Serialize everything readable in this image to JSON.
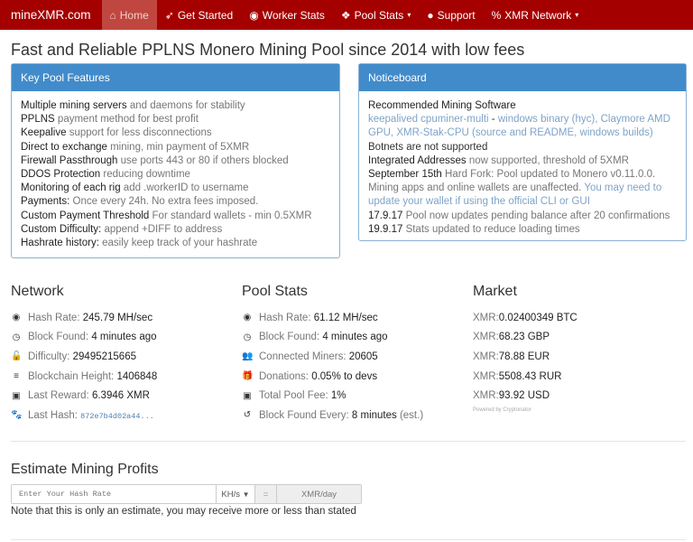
{
  "nav": {
    "brand": "mineXMR.com",
    "items": [
      {
        "label": "Home",
        "icon": "home-icon"
      },
      {
        "label": "Get Started",
        "icon": "rocket-icon"
      },
      {
        "label": "Worker Stats",
        "icon": "dashboard-icon"
      },
      {
        "label": "Pool Stats",
        "icon": "cubes-icon",
        "caret": "▾"
      },
      {
        "label": "Support",
        "icon": "comments-icon"
      },
      {
        "label": "XMR Network",
        "icon": "link-icon",
        "caret": "▾"
      }
    ]
  },
  "title": "Fast and Reliable PPLNS Monero Mining Pool since 2014 with low fees",
  "features": {
    "title": "Key Pool Features",
    "items": [
      [
        "Multiple mining servers",
        "and daemons for stability"
      ],
      [
        "PPLNS",
        "payment method for best profit"
      ],
      [
        "Keepalive",
        "support for less disconnections"
      ],
      [
        "Direct to exchange",
        "mining, min payment of 5XMR"
      ],
      [
        "Firewall Passthrough",
        "use ports 443 or 80 if others blocked"
      ],
      [
        "DDOS Protection",
        "reducing downtime"
      ],
      [
        "Monitoring of each rig",
        "add .workerID to username"
      ],
      [
        "Payments:",
        "Once every 24h. No extra fees imposed."
      ],
      [
        "Custom Payment Threshold",
        "For standard wallets - min 0.5XMR"
      ],
      [
        "Custom Difficulty:",
        "append +DIFF to address"
      ],
      [
        "Hashrate history:",
        "easily keep track of your hashrate"
      ]
    ]
  },
  "notice": {
    "title": "Noticeboard",
    "software_heading": "Recommended Mining Software",
    "link1": "keepalived cpuminer-multi",
    "sep1": " - ",
    "link2": "windows binary (hyc)",
    "sep2": ", ",
    "link3": "Claymore AMD GPU",
    "sep3": ", ",
    "link4": "XMR-Stak-CPU",
    "paren_open": " (",
    "link5": "source and README",
    "sep4": ", ",
    "link6": "windows builds",
    "paren_close": ")",
    "botnets": "Botnets are not supported",
    "ia_b": "Integrated Addresses",
    "ia_t": " now supported, threshold of 5XMR",
    "fork_b": "September 15th",
    "fork_t": " Hard Fork: Pool updated to Monero v0.11.0.0. Mining apps and online wallets are unaffected. ",
    "fork_l": "You may need to update your wallet if using the official CLI or GUI",
    "n1_b": "17.9.17",
    "n1_t": " Pool now updates pending balance after 20 confirmations",
    "n2_b": "19.9.17",
    "n2_t": " Stats updated to reduce loading times"
  },
  "network": {
    "title": "Network",
    "rows": [
      {
        "icon": "dashboard-icon",
        "glyph": "◉",
        "label": "Hash Rate: ",
        "value": "245.79 MH/sec"
      },
      {
        "icon": "clock-icon",
        "glyph": "◷",
        "label": "Block Found: ",
        "value": "4 minutes ago"
      },
      {
        "icon": "unlock-icon",
        "glyph": "🔓",
        "label": "Difficulty: ",
        "value": "29495215665"
      },
      {
        "icon": "bars-icon",
        "glyph": "≡",
        "label": "Blockchain Height: ",
        "value": "1406848"
      },
      {
        "icon": "money-icon",
        "glyph": "▣",
        "label": "Last Reward: ",
        "value": "6.3946 XMR"
      },
      {
        "icon": "paw-icon",
        "glyph": "🐾",
        "label": "Last Hash: ",
        "value": "872e7b4d02a44..."
      }
    ]
  },
  "pool": {
    "title": "Pool Stats",
    "rows": [
      {
        "icon": "dashboard-icon",
        "glyph": "◉",
        "label": "Hash Rate: ",
        "value": "61.12 MH/sec"
      },
      {
        "icon": "clock-icon",
        "glyph": "◷",
        "label": "Block Found: ",
        "value": "4 minutes ago"
      },
      {
        "icon": "users-icon",
        "glyph": "👥",
        "label": "Connected Miners: ",
        "value": "20605"
      },
      {
        "icon": "gift-icon",
        "glyph": "🎁",
        "label": "Donations: ",
        "value": "0.05% to devs"
      },
      {
        "icon": "money-icon",
        "glyph": "▣",
        "label": "Total Pool Fee: ",
        "value": "1%"
      },
      {
        "icon": "history-icon",
        "glyph": "↺",
        "label": "Block Found Every: ",
        "value": "8 minutes",
        "extra": " (est.)"
      }
    ]
  },
  "market": {
    "title": "Market",
    "rows": [
      {
        "label": "XMR: ",
        "value": "0.02400349 BTC"
      },
      {
        "label": "XMR: ",
        "value": "68.23 GBP"
      },
      {
        "label": "XMR: ",
        "value": "78.88 EUR"
      },
      {
        "label": "XMR: ",
        "value": "5508.43 RUR"
      },
      {
        "label": "XMR: ",
        "value": "93.92 USD"
      }
    ],
    "powered": "Powered by Cryptonator"
  },
  "estimate": {
    "title": "Estimate Mining Profits",
    "placeholder": "Enter Your Hash Rate",
    "unit": "KH/s",
    "eq": "=",
    "result": "XMR/day",
    "note": "Note that this is only an estimate, you may receive more or less than stated"
  }
}
